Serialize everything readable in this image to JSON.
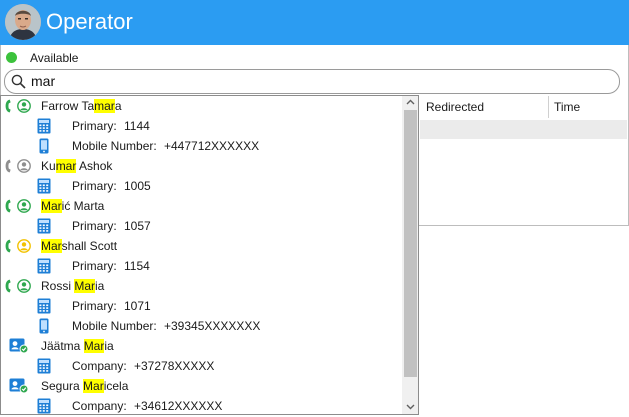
{
  "app": {
    "title": "Operator"
  },
  "status": {
    "text": "Available",
    "color": "#3cc23c"
  },
  "search": {
    "value": "mar"
  },
  "columns": {
    "redirected": "Redirected",
    "time": "Time"
  },
  "highlight_color": "#ffff00",
  "results": [
    {
      "type": "contact",
      "call_icon": "green",
      "presence": "green",
      "name_pre": "Farrow Ta",
      "name_hl": "mar",
      "name_post": "a"
    },
    {
      "type": "number",
      "device": "desk-phone",
      "label": "Primary:",
      "value": "1144"
    },
    {
      "type": "number",
      "device": "mobile-phone",
      "label": "Mobile Number:",
      "value": "+447712XXXXXX"
    },
    {
      "type": "contact",
      "call_icon": "gray",
      "presence": "gray",
      "name_pre": "Ku",
      "name_hl": "mar",
      "name_post": " Ashok"
    },
    {
      "type": "number",
      "device": "desk-phone",
      "label": "Primary:",
      "value": "1005"
    },
    {
      "type": "contact",
      "call_icon": "green",
      "presence": "green",
      "name_pre": "",
      "name_hl": "Mar",
      "name_post": "ić Marta"
    },
    {
      "type": "number",
      "device": "desk-phone",
      "label": "Primary:",
      "value": "1057"
    },
    {
      "type": "contact",
      "call_icon": "green",
      "presence": "yellow",
      "name_pre": "",
      "name_hl": "Mar",
      "name_post": "shall Scott"
    },
    {
      "type": "number",
      "device": "desk-phone",
      "label": "Primary:",
      "value": "1154"
    },
    {
      "type": "contact",
      "call_icon": "green",
      "presence": "green",
      "name_pre": "Rossi ",
      "name_hl": "Mar",
      "name_post": "ia"
    },
    {
      "type": "number",
      "device": "desk-phone",
      "label": "Primary:",
      "value": "1071"
    },
    {
      "type": "number",
      "device": "mobile-phone",
      "label": "Mobile Number:",
      "value": "+39345XXXXXXX"
    },
    {
      "type": "contact",
      "call_icon": "none",
      "presence": "phonebook",
      "name_pre": "Jäätma ",
      "name_hl": "Mar",
      "name_post": "ia"
    },
    {
      "type": "number",
      "device": "desk-phone",
      "label": "Company:",
      "value": "+37278XXXXX"
    },
    {
      "type": "contact",
      "call_icon": "none",
      "presence": "phonebook",
      "name_pre": "Segura ",
      "name_hl": "Mar",
      "name_post": "icela"
    },
    {
      "type": "number",
      "device": "desk-phone",
      "label": "Company:",
      "value": "+34612XXXXXX"
    }
  ]
}
